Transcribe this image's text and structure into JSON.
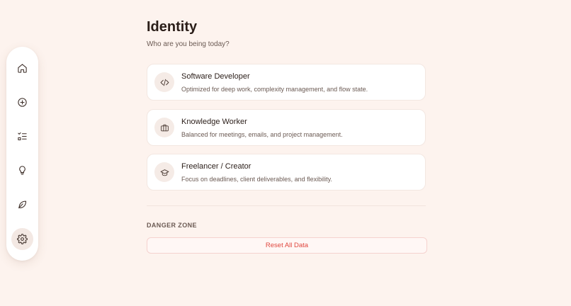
{
  "sidebar": {
    "items": [
      {
        "name": "home",
        "icon": "home-icon",
        "active": false
      },
      {
        "name": "add",
        "icon": "plus-circle-icon",
        "active": false
      },
      {
        "name": "tasks",
        "icon": "checklist-icon",
        "active": false
      },
      {
        "name": "ideas",
        "icon": "lightbulb-icon",
        "active": false
      },
      {
        "name": "wellness",
        "icon": "leaf-icon",
        "active": false
      },
      {
        "name": "settings",
        "icon": "gear-icon",
        "active": true
      }
    ]
  },
  "main": {
    "title": "Identity",
    "subtitle": "Who are you being today?",
    "identities": [
      {
        "title": "Software Developer",
        "description": "Optimized for deep work, complexity management, and flow state.",
        "icon": "code-icon"
      },
      {
        "title": "Knowledge Worker",
        "description": "Balanced for meetings, emails, and project management.",
        "icon": "briefcase-icon"
      },
      {
        "title": "Freelancer / Creator",
        "description": "Focus on deadlines, client deliverables, and flexibility.",
        "icon": "graduation-cap-icon"
      }
    ],
    "danger_zone": {
      "heading": "DANGER ZONE",
      "reset_label": "Reset All Data"
    }
  },
  "colors": {
    "background": "#fdf3ee",
    "card": "#ffffff",
    "danger_text": "#e0483f",
    "danger_border": "#f5d2cf"
  }
}
